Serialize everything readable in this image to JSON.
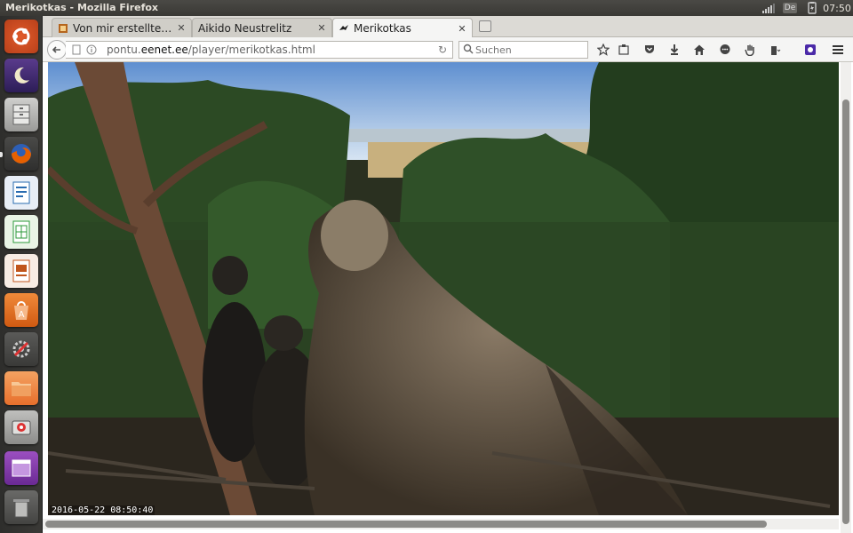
{
  "panel": {
    "window_title": "Merikotkas - Mozilla Firefox",
    "keyboard_layout": "De",
    "clock": "07:50"
  },
  "launcher": {
    "items": [
      {
        "name": "ubuntu-dash-icon"
      },
      {
        "name": "system-icon"
      },
      {
        "name": "files-drawer-icon"
      },
      {
        "name": "firefox-icon",
        "running": true
      },
      {
        "name": "writer-icon"
      },
      {
        "name": "calc-icon"
      },
      {
        "name": "impress-icon"
      },
      {
        "name": "software-center-icon"
      },
      {
        "name": "settings-icon"
      },
      {
        "name": "folder-icon"
      },
      {
        "name": "disk-icon"
      },
      {
        "name": "workspace-switcher-icon"
      },
      {
        "name": "trash-icon"
      }
    ]
  },
  "tabs": [
    {
      "label": "Von mir erstellte Int…",
      "icon": "film-icon",
      "active": false
    },
    {
      "label": "Aikido Neustrelitz",
      "icon": "none",
      "active": false
    },
    {
      "label": "Merikotkas",
      "icon": "eagle-icon",
      "active": true
    }
  ],
  "navbar": {
    "url_prefix": "pontu.",
    "url_host": "eenet.ee",
    "url_path": "/player/merikotkas.html",
    "search_placeholder": "Suchen"
  },
  "video": {
    "timestamp": "2016-05-22  08:50:40"
  },
  "colors": {
    "panel": "#3c3b37",
    "firefox_orange": "#e66000",
    "purple_ext": "#4b2aa8"
  }
}
